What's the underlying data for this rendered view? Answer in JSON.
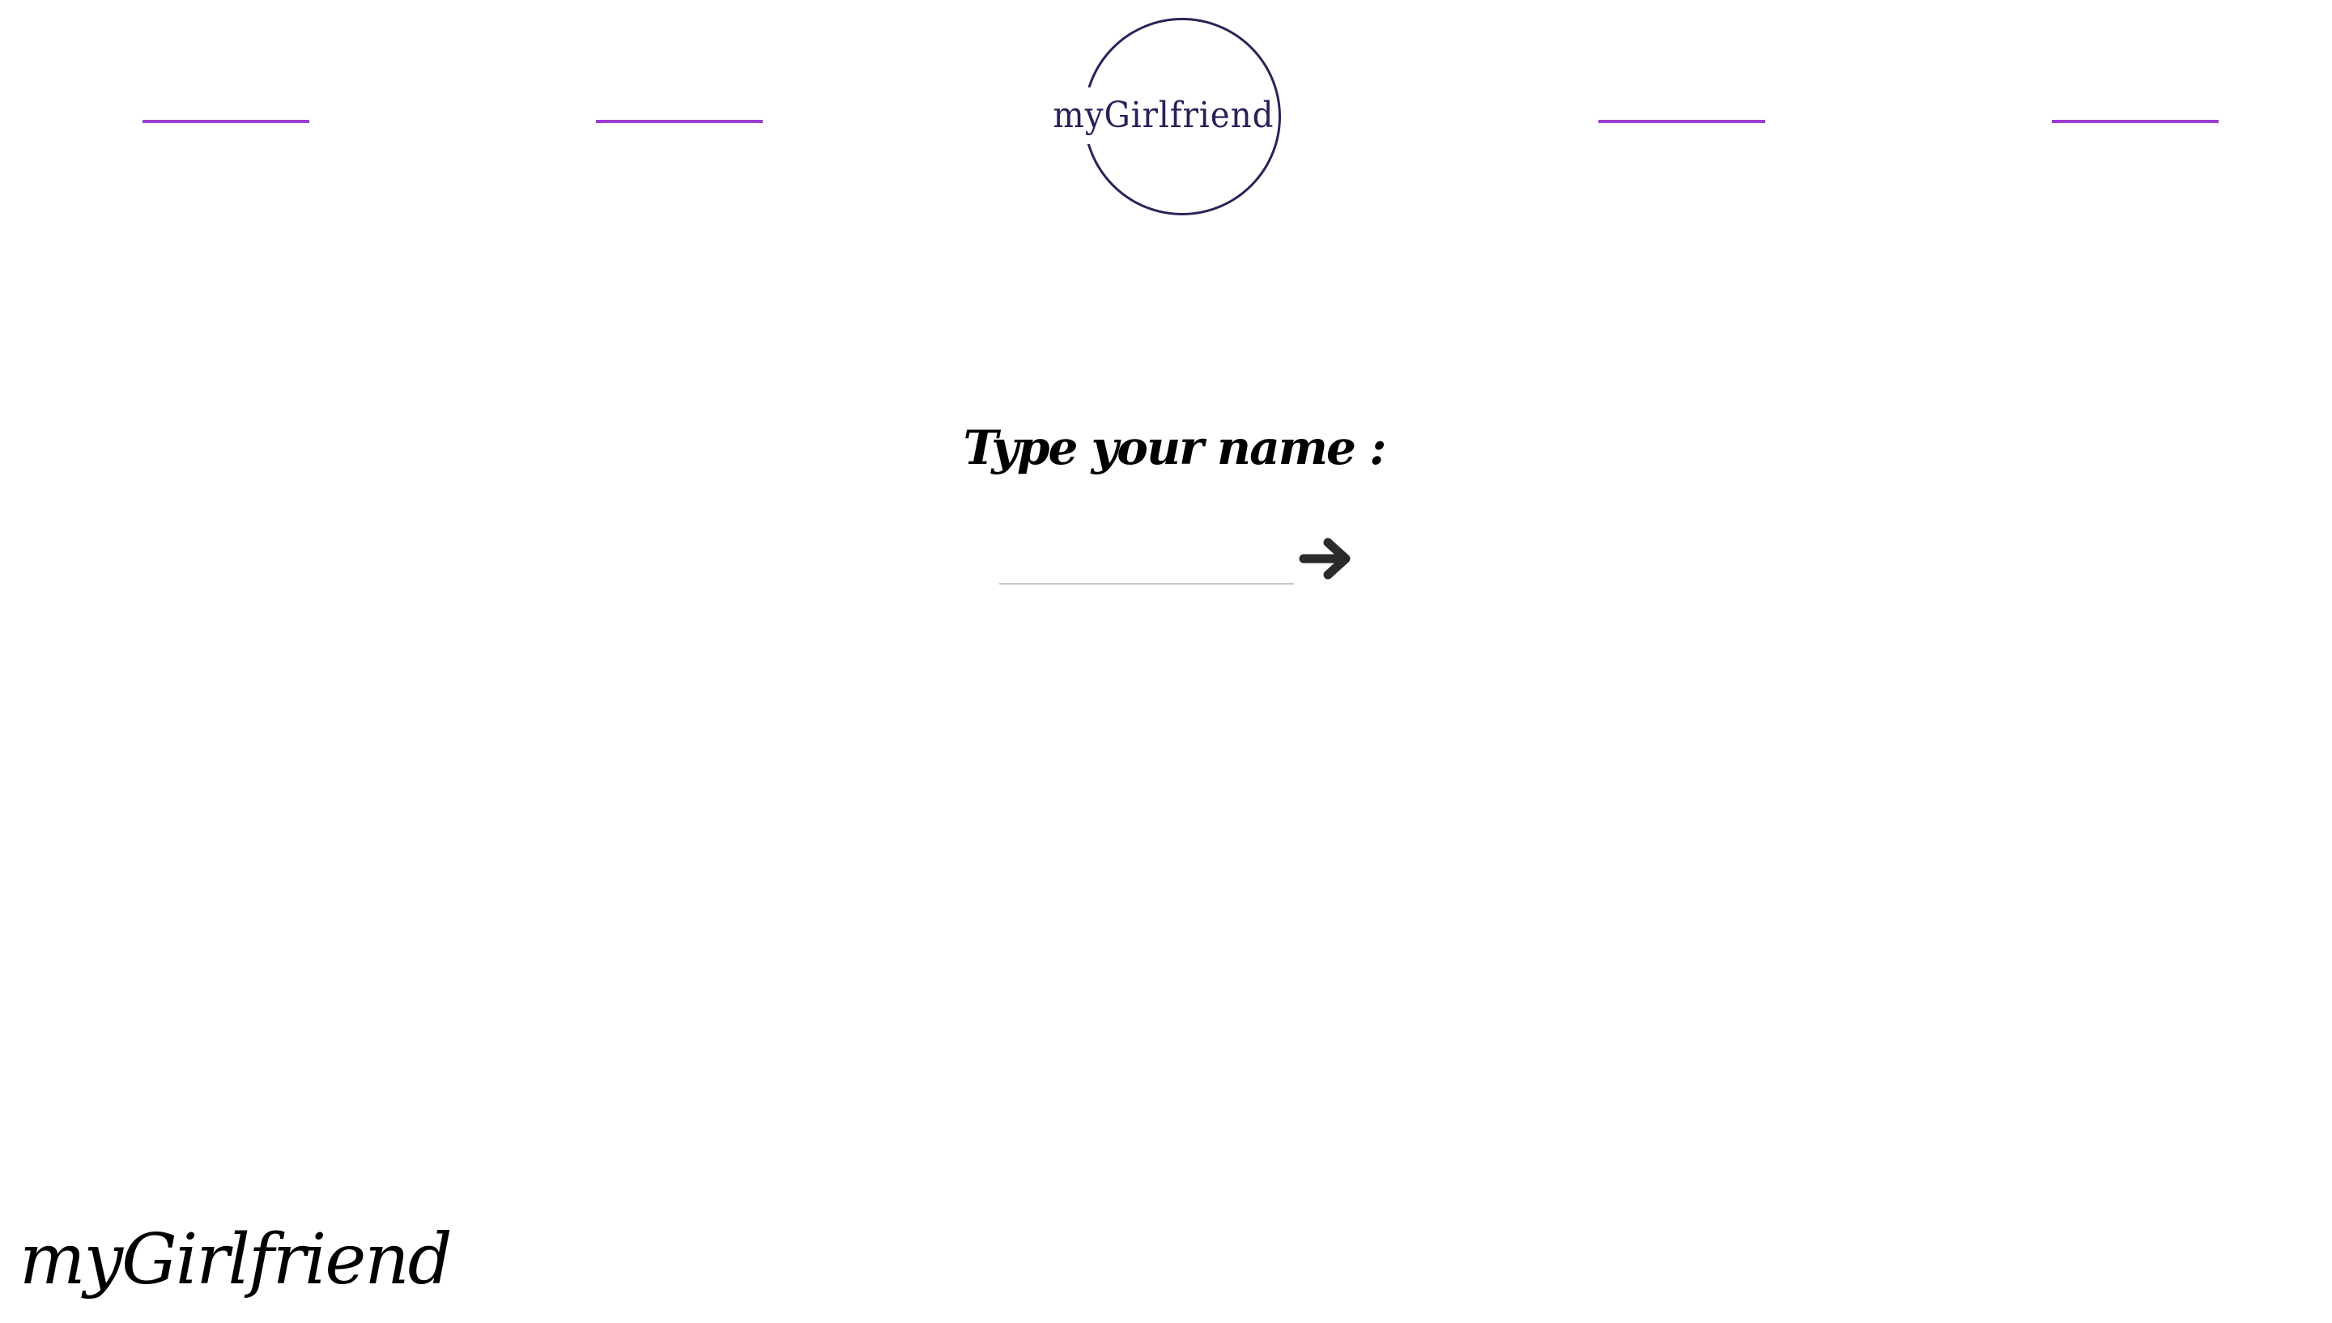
{
  "header": {
    "logo_text": "myGirlfriend",
    "accent_color": "#9b3fd1",
    "logo_color": "#2a1f5a"
  },
  "main": {
    "prompt": "Type your name :",
    "name_input": {
      "value": "",
      "placeholder": ""
    },
    "submit_icon": "right-arrow-icon"
  },
  "footer": {
    "brand": "myGirlfriend"
  }
}
